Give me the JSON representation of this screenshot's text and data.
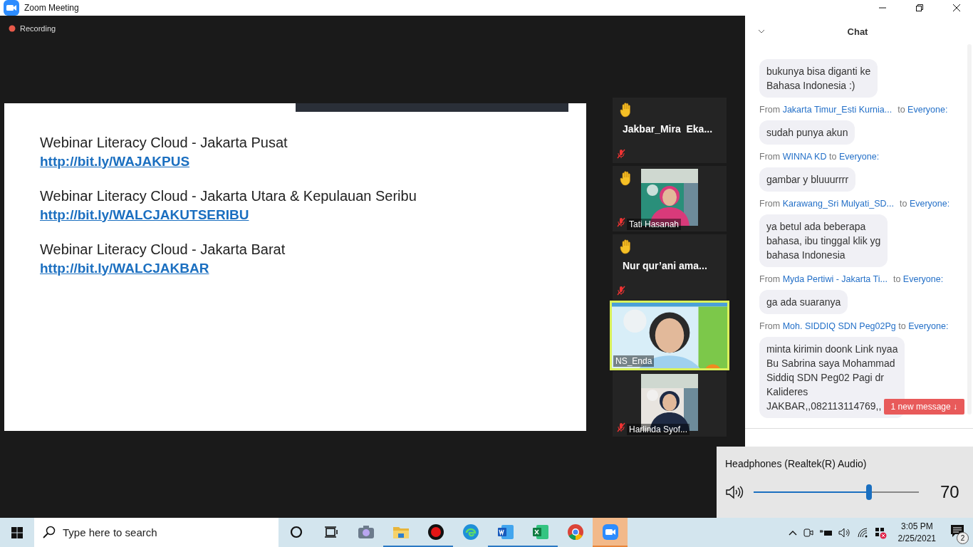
{
  "window": {
    "title": "Zoom Meeting"
  },
  "recording": {
    "label": "Recording"
  },
  "slide": {
    "entries": [
      {
        "title": "Webinar Literacy Cloud - Jakarta Pusat",
        "link": "http://bit.ly/WAJAKPUS"
      },
      {
        "title": "Webinar Literacy Cloud - Jakarta Utara & Kepulauan Seribu",
        "link": "http://bit.ly/WALCJAKUTSERIBU"
      },
      {
        "title": "Webinar Literacy Cloud - Jakarta Barat",
        "link": "http://bit.ly/WALCJAKBAR"
      }
    ]
  },
  "participants": [
    {
      "kind": "name",
      "name": "Jakbar_Mira  Eka...",
      "hand_raised": true,
      "muted": true,
      "active_speaker": false
    },
    {
      "kind": "video",
      "name": "Tati Hasanah",
      "hand_raised": true,
      "muted": true,
      "active_speaker": false
    },
    {
      "kind": "name",
      "name": "Nur qur’ani ama...",
      "hand_raised": true,
      "muted": true,
      "active_speaker": false
    },
    {
      "kind": "video",
      "name": "NS_Enda",
      "hand_raised": false,
      "muted": false,
      "active_speaker": true
    },
    {
      "kind": "video",
      "name": "Harlinda Syof...",
      "hand_raised": false,
      "muted": true,
      "active_speaker": false
    }
  ],
  "chat": {
    "title": "Chat",
    "messages": [
      {
        "text": "bukunya bisa diganti ke\nBahasa Indonesia :)"
      },
      {
        "prefix": "From",
        "from": "Jakarta Timur_Esti Kurnia...",
        "joiner": "to",
        "to": "Everyone:",
        "text": "sudah punya akun"
      },
      {
        "prefix": "From",
        "from": "WINNA KD",
        "joiner": "to",
        "to": "Everyone:",
        "text": "gambar y bluuurrrr"
      },
      {
        "prefix": "From",
        "from": "Karawang_Sri Mulyati_SD...",
        "joiner": "to",
        "to": "Everyone:",
        "text": "ya betul ada beberapa\nbahasa, ibu tinggal klik yg\nbahasa Indonesia"
      },
      {
        "prefix": "From",
        "from": "Myda Pertiwi - Jakarta Ti...",
        "joiner": "to",
        "to": "Everyone:",
        "text": "ga ada suaranya"
      },
      {
        "prefix": "From",
        "from": "Moh. SIDDIQ SDN Peg02Pg",
        "joiner": "to",
        "to": "Everyone:",
        "text": "minta kirimin doonk Link nyaa\nBu Sabrina saya Mohammad\nSiddiq SDN Peg02 Pagi dr\nKalideres\nJAKBAR,,082113114769,,"
      }
    ],
    "new_message_badge": "1 new message ↓"
  },
  "volume": {
    "device": "Headphones (Realtek(R) Audio)",
    "level": 0.7,
    "reading": "70"
  },
  "taskbar": {
    "search_placeholder": "Type here to search",
    "apps": [
      {
        "kind": "task-view-circle",
        "running": false,
        "selected": false
      },
      {
        "kind": "task-view",
        "running": false,
        "selected": false
      },
      {
        "kind": "camera",
        "running": false,
        "selected": false
      },
      {
        "kind": "folder",
        "running": true,
        "selected": false
      },
      {
        "kind": "record",
        "running": true,
        "selected": false
      },
      {
        "kind": "edge",
        "running": false,
        "selected": false
      },
      {
        "kind": "word",
        "running": true,
        "selected": false
      },
      {
        "kind": "excel",
        "running": true,
        "selected": false
      },
      {
        "kind": "chrome",
        "running": false,
        "selected": false
      },
      {
        "kind": "zoom",
        "running": true,
        "selected": true
      }
    ],
    "time": "3:05 PM",
    "date": "2/25/2021",
    "notifications": "2"
  }
}
